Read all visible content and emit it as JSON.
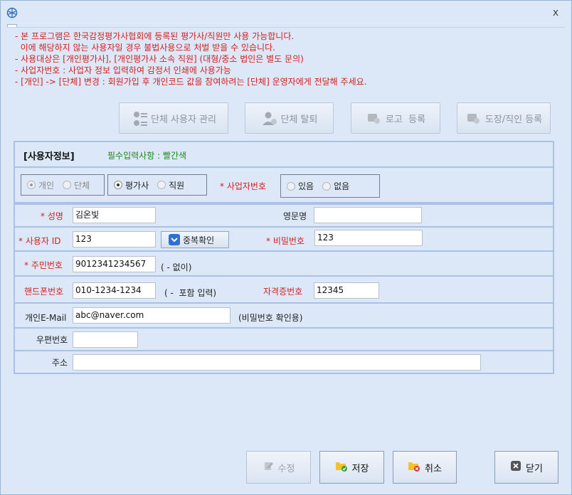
{
  "window": {
    "close_label": "x"
  },
  "notice": {
    "lines": [
      "- 본 프로그램은 한국감정평가사협회에 등록된 평가사/직원만 사용 가능합니다.",
      "  이에 해당하지 않는 사용자일 경우 불법사용으로 처벌 받을 수 있습니다.",
      "- 사용대상은 [개인평가사], [개인평가사 소속 직원] (대형/중소 법인은 별도 문의)",
      "- 사업자번호 : 사업자 정보 입력하여 감정서 인쇄에 사용가능",
      "- [개인] -> [단체] 변경 : 회원가입 후 개인코드 값을 참여하려는 [단체] 운영자에게 전달해 주세요."
    ]
  },
  "toolbar": {
    "group_user_mgmt": "단체 사용자 관리",
    "group_leave": "단체 탈퇴",
    "logo_register": "로고  등록",
    "seal_register": "도장/직인 등록"
  },
  "section": {
    "title": "[사용자정보]",
    "required_note": "필수입력사항 : 빨간색"
  },
  "type": {
    "individual": "개인",
    "group": "단체",
    "appraiser": "평가사",
    "staff": "직원",
    "biz_no_label": "* 사업자번호",
    "has": "있음",
    "none": "없음"
  },
  "form": {
    "name_label": "* 성명",
    "name_value": "김온빛",
    "eng_name_label": "영문명",
    "eng_name_value": "",
    "user_id_label": "* 사용자 ID",
    "user_id_value": "123",
    "dup_check": "중복확인",
    "password_label": "* 비밀번호",
    "password_value": "123",
    "resident_label": "* 주민번호",
    "resident_value": "9012341234567",
    "resident_hint": "( - 없이)",
    "phone_label": "핸드폰번호",
    "phone_value": "010-1234-1234",
    "phone_hint": "( -  포함 입력)",
    "license_label": "자격증번호",
    "license_value": "12345",
    "email_label": "개인E-Mail",
    "email_value": "abc@naver.com",
    "email_hint": "(비밀번호 확인용)",
    "zip_label": "우편번호",
    "zip_value": "",
    "address_label": "주소",
    "address_value": ""
  },
  "footer": {
    "edit": "수정",
    "save": "저장",
    "cancel": "취소",
    "close": "닫기"
  },
  "colors": {
    "required": "#d42020",
    "required_note": "#1a8a1a",
    "background": "#dce8f7",
    "border": "#a9c1e2"
  }
}
